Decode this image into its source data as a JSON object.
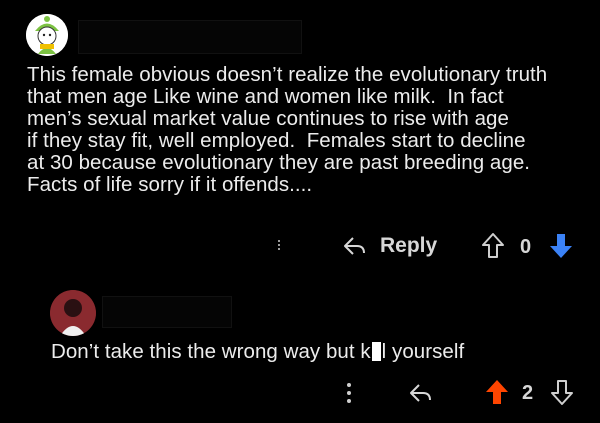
{
  "comments": [
    {
      "text": "This female obvious doesn’t realize the evolutionary truth\nthat men age Like wine and women like milk.  In fact\nmen’s sexual market value continues to rise with age\nif they stay fit, well employed.  Females start to decline\nat 30 because evolutionary they are past breeding age.\nFacts of life sorry if it offends....",
      "reply_label": "Reply",
      "vote_count": "0",
      "avatar_icon": "cartoon-character-avatar-icon",
      "upvote_active": false,
      "downvote_active": true
    },
    {
      "text_before": "Don’t take this the wrong way but k",
      "text_after": "l yourself",
      "reply_label": "",
      "vote_count": "2",
      "avatar_icon": "photo-avatar",
      "upvote_active": true,
      "downvote_active": false
    }
  ],
  "colors": {
    "background": "#000000",
    "text": "#ececec",
    "upvote_active": "#ff4500",
    "downvote_active": "#3b82f6",
    "icon_inactive": "#cfcfcf"
  },
  "icons": [
    "more-vertical-icon",
    "reply-arrow-icon",
    "upvote-arrow-icon",
    "downvote-arrow-icon"
  ]
}
